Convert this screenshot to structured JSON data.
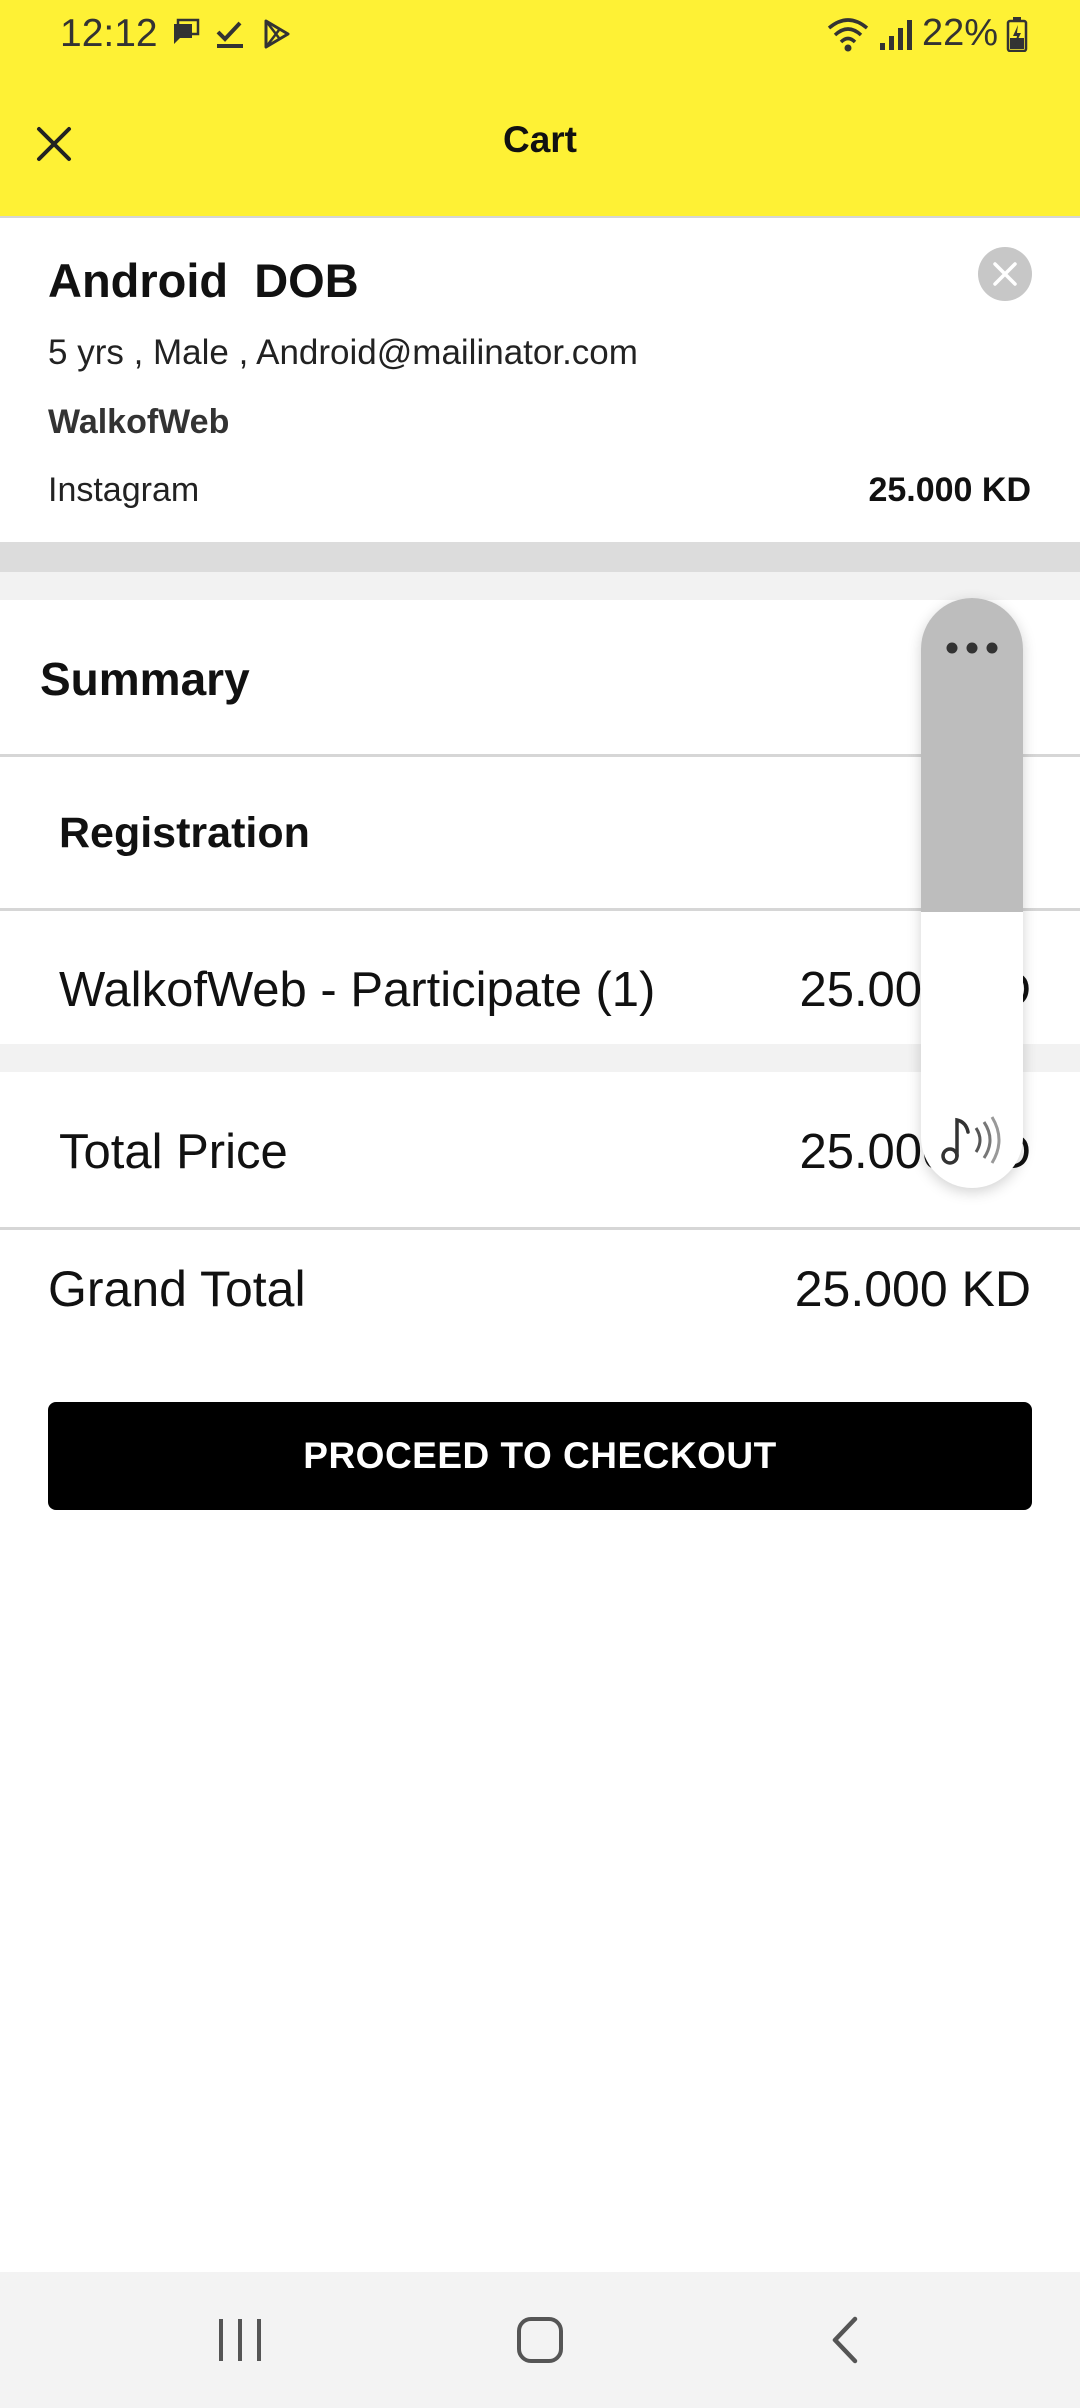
{
  "status_bar": {
    "time": "12:12",
    "battery": "22%"
  },
  "app_bar": {
    "title": "Cart"
  },
  "cart_item": {
    "participant_name": "Android  DOB",
    "details": "5 yrs , Male , Android@mailinator.com",
    "event": "WalkofWeb",
    "ticket": "Instagram",
    "price": "25.000 KD"
  },
  "summary": {
    "heading": "Summary",
    "registration_heading": "Registration",
    "line_item_label": "WalkofWeb - Participate (1)",
    "line_item_value": "25.000 KD",
    "total_label": "Total Price",
    "total_value": "25.000 KD"
  },
  "grand_total": {
    "label": "Grand Total",
    "value": "25.000 KD"
  },
  "checkout_button": "PROCEED TO CHECKOUT",
  "theme": {
    "accent": "#fef135",
    "button": "#000000"
  },
  "icons": [
    "close-icon",
    "remove-item-icon",
    "more-icon",
    "sound-icon",
    "recents-icon",
    "home-icon",
    "back-icon"
  ]
}
